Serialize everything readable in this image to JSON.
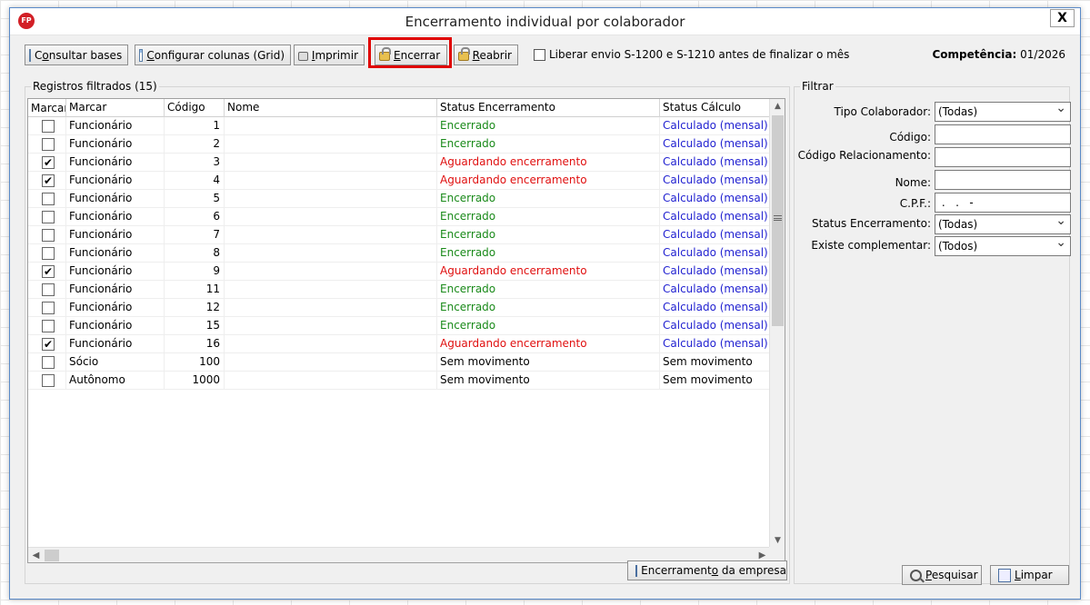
{
  "window": {
    "title": "Encerramento individual por colaborador",
    "app_icon_text": "FP",
    "close_label": "X"
  },
  "toolbar": {
    "consultar_bases": {
      "pre": "C",
      "u": "o",
      "post": "nsultar bases"
    },
    "configurar_colunas": {
      "pre": "",
      "u": "C",
      "post": "onfigurar colunas (Grid)"
    },
    "imprimir": {
      "pre": "",
      "u": "I",
      "post": "mprimir"
    },
    "encerrar": {
      "pre": "",
      "u": "E",
      "post": "ncerrar"
    },
    "reabrir": {
      "pre": "",
      "u": "R",
      "post": "eabrir"
    },
    "liberar_envio_label": "Liberar envio S-1200 e S-1210 antes de finalizar o mês",
    "competencia_label": "Competência:",
    "competencia_value": "01/2026"
  },
  "registros": {
    "group_label": "Registros filtrados (15)",
    "columns": [
      "Marcar",
      "Marcar",
      "Código",
      "Nome",
      "Status Encerramento",
      "Status Cálculo"
    ],
    "rows": [
      {
        "checked": false,
        "tipo": "Funcionário",
        "codigo": "1",
        "nome": "",
        "status": "Encerrado",
        "status_kind": "green",
        "calculo": "Calculado (mensal)",
        "calc_kind": "blue"
      },
      {
        "checked": false,
        "tipo": "Funcionário",
        "codigo": "2",
        "nome": "",
        "status": "Encerrado",
        "status_kind": "green",
        "calculo": "Calculado (mensal)",
        "calc_kind": "blue"
      },
      {
        "checked": true,
        "tipo": "Funcionário",
        "codigo": "3",
        "nome": "",
        "status": "Aguardando encerramento",
        "status_kind": "red",
        "calculo": "Calculado (mensal)",
        "calc_kind": "blue"
      },
      {
        "checked": true,
        "tipo": "Funcionário",
        "codigo": "4",
        "nome": "",
        "status": "Aguardando encerramento",
        "status_kind": "red",
        "calculo": "Calculado (mensal)",
        "calc_kind": "blue"
      },
      {
        "checked": false,
        "tipo": "Funcionário",
        "codigo": "5",
        "nome": "",
        "status": "Encerrado",
        "status_kind": "green",
        "calculo": "Calculado (mensal)",
        "calc_kind": "blue"
      },
      {
        "checked": false,
        "tipo": "Funcionário",
        "codigo": "6",
        "nome": "",
        "status": "Encerrado",
        "status_kind": "green",
        "calculo": "Calculado (mensal)",
        "calc_kind": "blue"
      },
      {
        "checked": false,
        "tipo": "Funcionário",
        "codigo": "7",
        "nome": "",
        "status": "Encerrado",
        "status_kind": "green",
        "calculo": "Calculado (mensal)",
        "calc_kind": "blue"
      },
      {
        "checked": false,
        "tipo": "Funcionário",
        "codigo": "8",
        "nome": "",
        "status": "Encerrado",
        "status_kind": "green",
        "calculo": "Calculado (mensal)",
        "calc_kind": "blue"
      },
      {
        "checked": true,
        "tipo": "Funcionário",
        "codigo": "9",
        "nome": "",
        "status": "Aguardando encerramento",
        "status_kind": "red",
        "calculo": "Calculado (mensal)",
        "calc_kind": "blue"
      },
      {
        "checked": false,
        "tipo": "Funcionário",
        "codigo": "11",
        "nome": "",
        "status": "Encerrado",
        "status_kind": "green",
        "calculo": "Calculado (mensal)",
        "calc_kind": "blue"
      },
      {
        "checked": false,
        "tipo": "Funcionário",
        "codigo": "12",
        "nome": "",
        "status": "Encerrado",
        "status_kind": "green",
        "calculo": "Calculado (mensal)",
        "calc_kind": "blue"
      },
      {
        "checked": false,
        "tipo": "Funcionário",
        "codigo": "15",
        "nome": "",
        "status": "Encerrado",
        "status_kind": "green",
        "calculo": "Calculado (mensal)",
        "calc_kind": "blue"
      },
      {
        "checked": true,
        "tipo": "Funcionário",
        "codigo": "16",
        "nome": "",
        "status": "Aguardando encerramento",
        "status_kind": "red",
        "calculo": "Calculado (mensal)",
        "calc_kind": "blue"
      },
      {
        "checked": false,
        "tipo": "Sócio",
        "codigo": "100",
        "nome": "",
        "status": "Sem movimento",
        "status_kind": "black",
        "calculo": "Sem movimento",
        "calc_kind": "black"
      },
      {
        "checked": false,
        "tipo": "Autônomo",
        "codigo": "1000",
        "nome": "",
        "status": "Sem movimento",
        "status_kind": "black",
        "calculo": "Sem movimento",
        "calc_kind": "black"
      }
    ],
    "encerramento_empresa": {
      "pre": "Encerrament",
      "u": "o",
      "post": " da empresa"
    }
  },
  "filtrar": {
    "group_label": "Filtrar",
    "tipo_colaborador_label": "Tipo Colaborador:",
    "tipo_colaborador_value": "(Todas)",
    "codigo_label": "Código:",
    "codigo_value": "",
    "codigo_relacionamento_label": "Código Relacionamento:",
    "codigo_relacionamento_value": "",
    "nome_label": "Nome:",
    "nome_value": "",
    "cpf_label": "C.P.F.:",
    "cpf_value": " .   .   -",
    "status_encerramento_label": "Status Encerramento:",
    "status_encerramento_value": "(Todas)",
    "existe_complementar_label": "Existe complementar:",
    "existe_complementar_value": "(Todos)",
    "pesquisar": {
      "pre": "",
      "u": "P",
      "post": "esquisar"
    },
    "limpar": {
      "pre": "",
      "u": "L",
      "post": "impar"
    }
  },
  "colors": {
    "encerrado": "#1a8a1a",
    "aguardando": "#e01010",
    "calculado": "#1f1fd0",
    "highlight": "#e00000"
  }
}
